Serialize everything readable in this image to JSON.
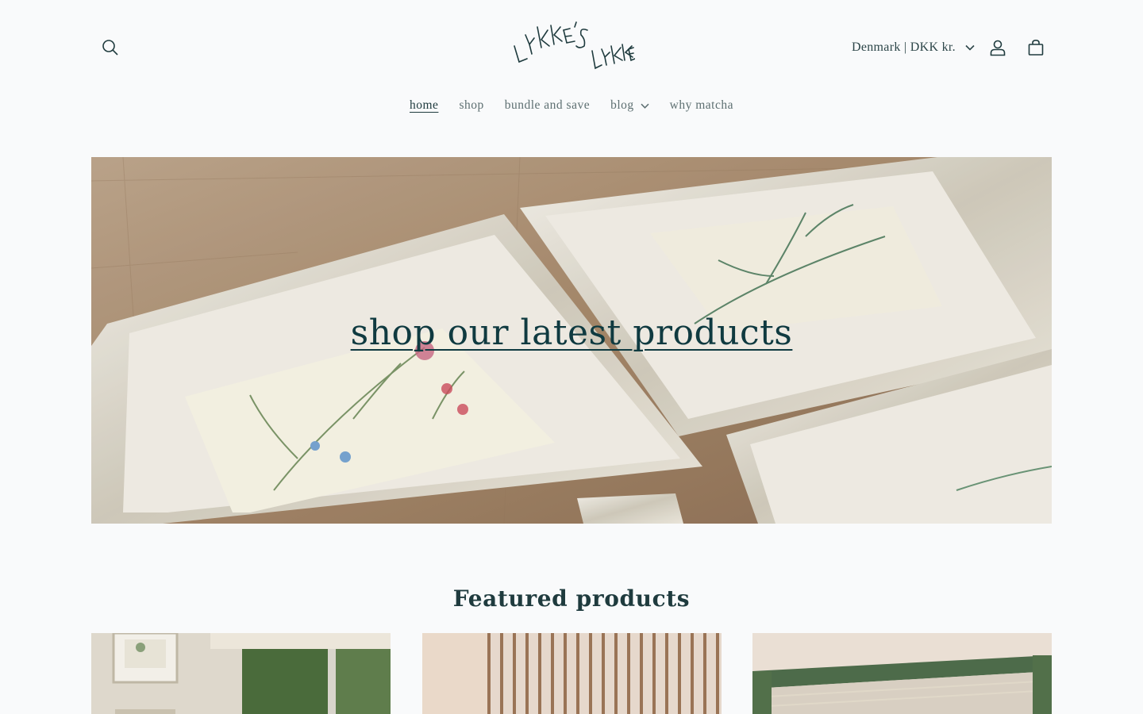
{
  "header": {
    "logo_text": "LYKKE'S LYKKE",
    "locale_label": "Denmark | DKK kr.",
    "icons": {
      "search": "search-icon",
      "account": "user-icon",
      "cart": "shopping-bag-icon",
      "locale_chevron": "chevron-down-icon"
    }
  },
  "nav": {
    "items": [
      {
        "label": "home",
        "active": true
      },
      {
        "label": "shop"
      },
      {
        "label": "bundle and save"
      },
      {
        "label": "blog",
        "has_dropdown": true
      },
      {
        "label": "why matcha"
      }
    ]
  },
  "hero": {
    "title": "shop our latest products"
  },
  "featured": {
    "title": "Featured products"
  },
  "colors": {
    "background": "#f9fafb",
    "text": "#1f3b3e",
    "nav_inactive": "#5d6f71",
    "hero_wood": "#a3876a"
  }
}
